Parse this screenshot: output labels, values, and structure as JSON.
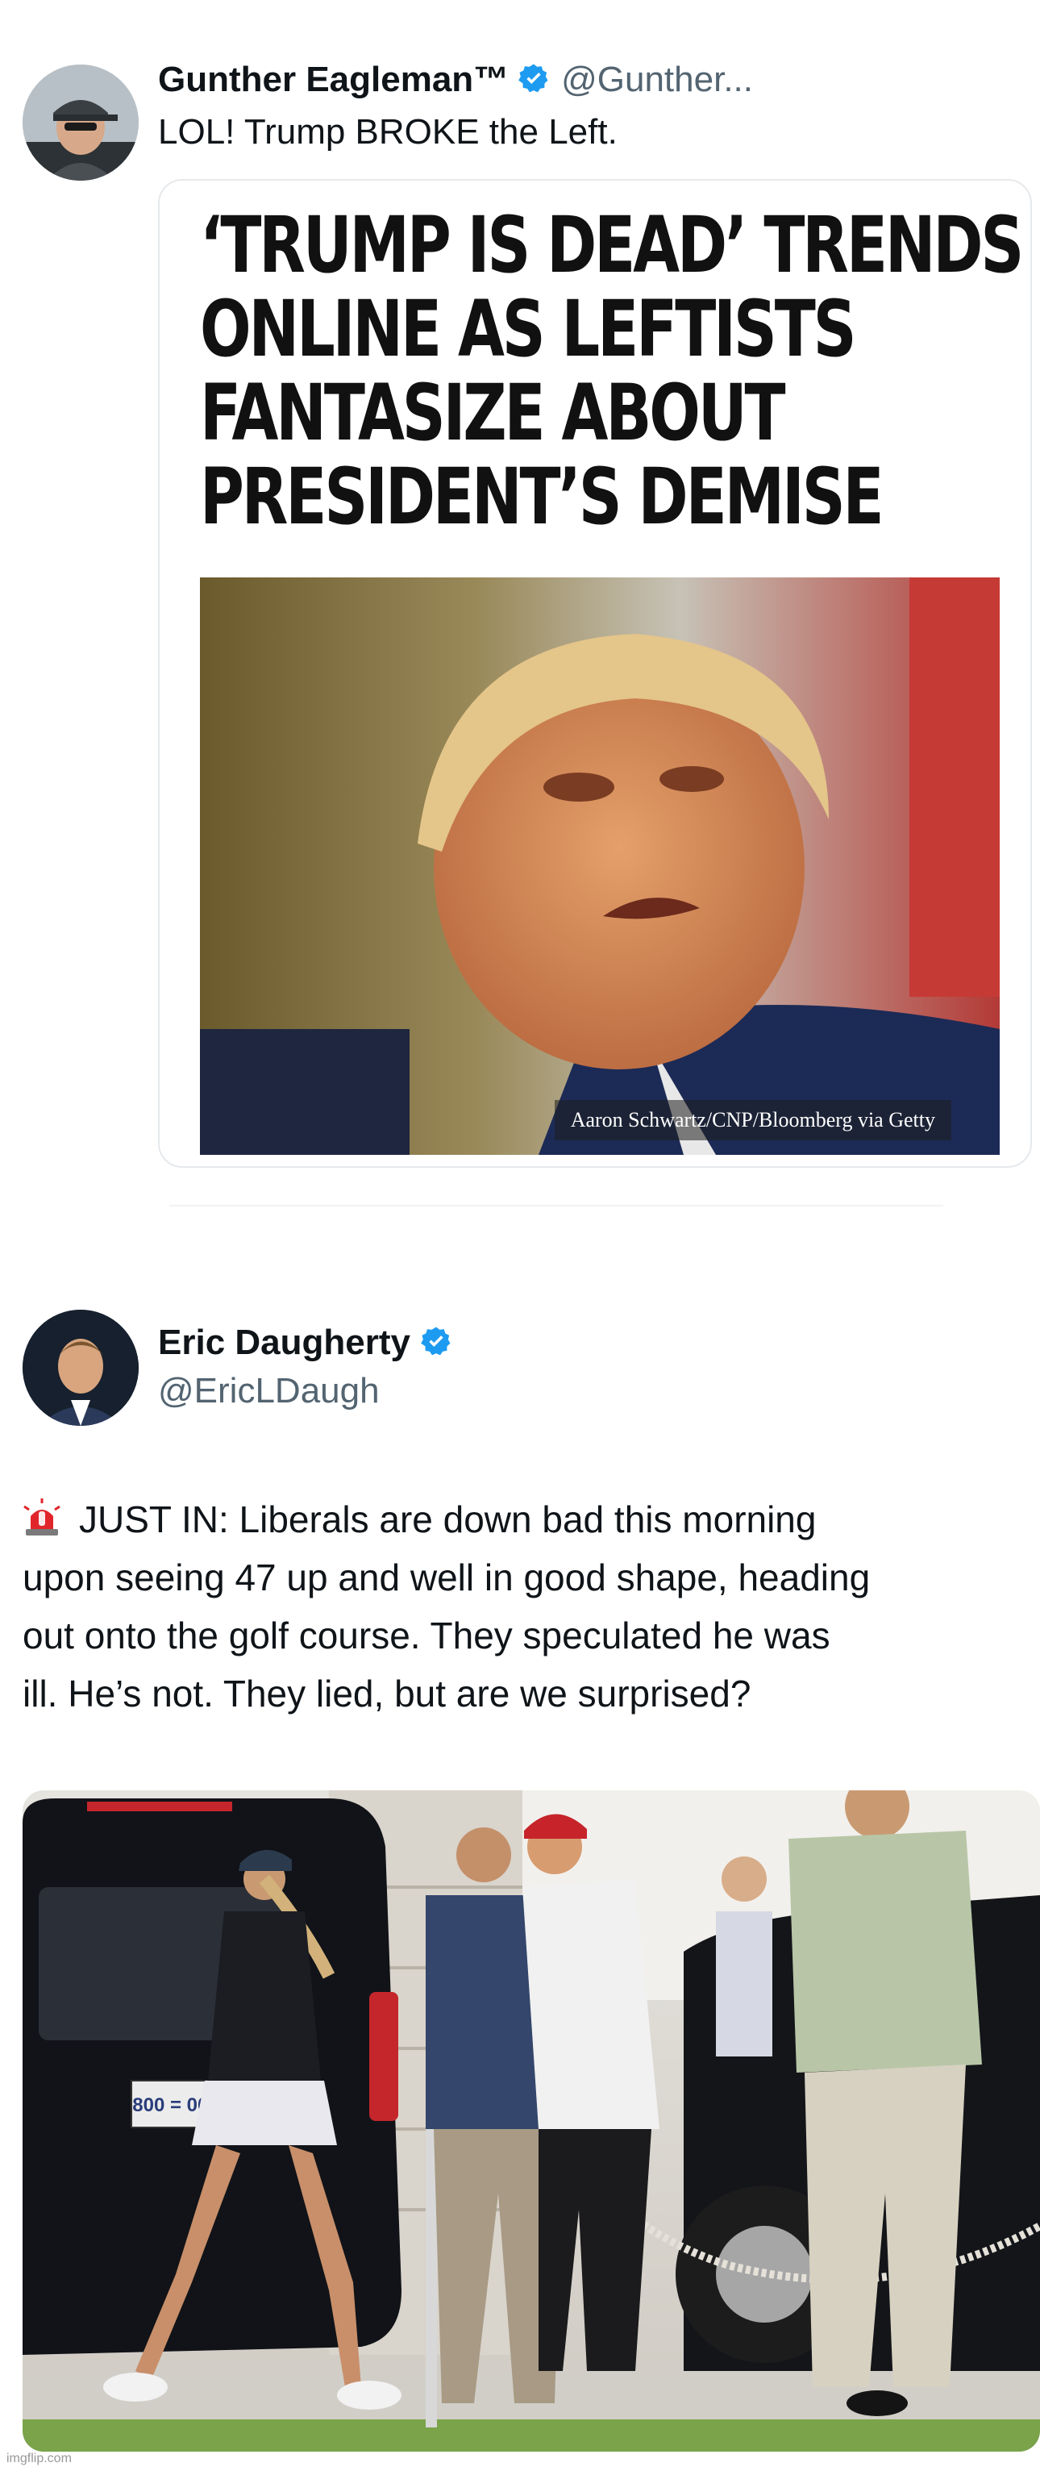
{
  "tweet1": {
    "display_name": "Gunther Eagleman™",
    "handle": "@Gunther...",
    "text": "LOL! Trump BROKE the Left.",
    "card": {
      "headline_lines": [
        "‘TRUMP IS DEAD’ TRENDS",
        "ONLINE AS LEFTISTS",
        "FANTASIZE ABOUT",
        "PRESIDENT’S DEMISE"
      ],
      "photo_credit": "Aaron Schwartz/CNP/Bloomberg via Getty"
    }
  },
  "tweet2": {
    "display_name": "Eric Daugherty",
    "handle": "@EricLDaugh",
    "text_lines": [
      "JUST IN: Liberals are down bad this morning",
      "upon seeing 47 up and well in good shape, heading",
      "out onto the golf course. They speculated he was",
      "ill. He’s not. They lied, but are we surprised?"
    ],
    "photo": {
      "plate": "800 = 002"
    }
  },
  "watermark": "imgflip.com",
  "colors": {
    "verified": "#1d9bf0",
    "text": "#0f1419",
    "secondary": "#536471"
  }
}
